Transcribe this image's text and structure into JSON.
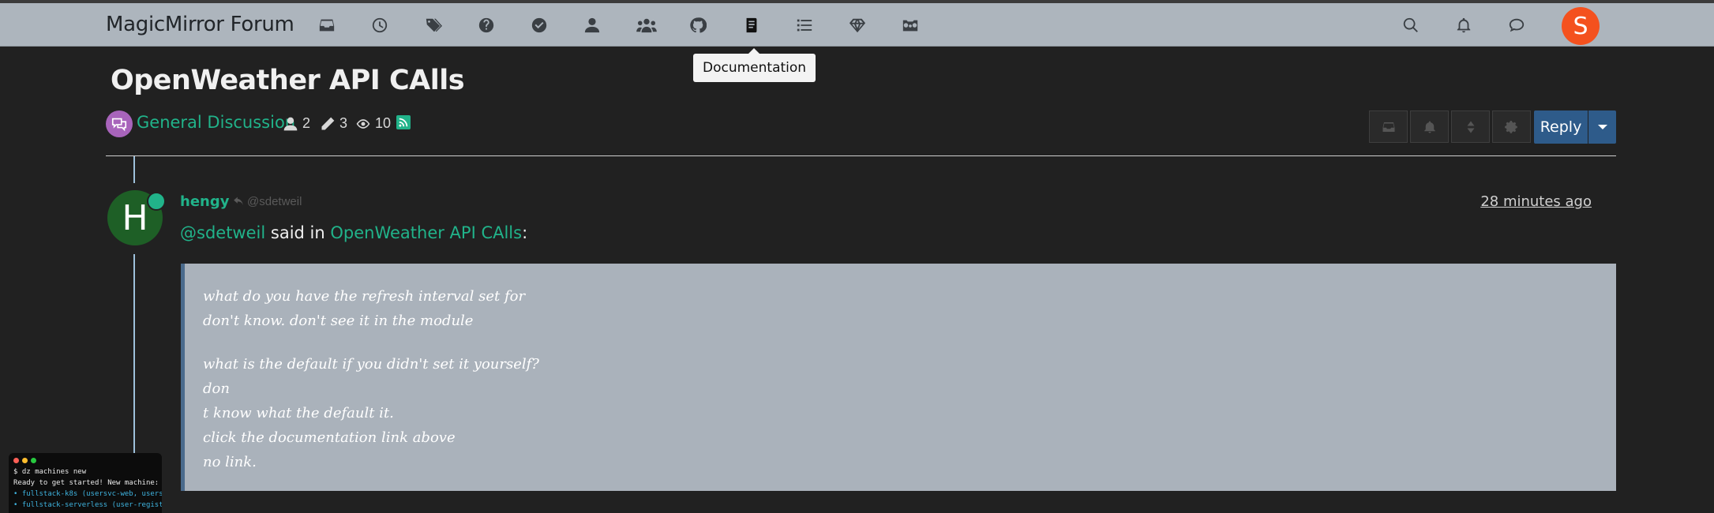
{
  "app": {
    "brand": "MagicMirror Forum"
  },
  "nav": {
    "items": [
      {
        "name": "unread-icon"
      },
      {
        "name": "recent-icon"
      },
      {
        "name": "tags-icon"
      },
      {
        "name": "help-icon"
      },
      {
        "name": "solved-icon"
      },
      {
        "name": "user-icon"
      },
      {
        "name": "groups-icon"
      },
      {
        "name": "github-icon"
      },
      {
        "name": "documentation-icon",
        "active": true
      },
      {
        "name": "list-icon"
      },
      {
        "name": "gem-icon"
      },
      {
        "name": "camera-icon"
      }
    ],
    "right": [
      "search-icon",
      "notifications-icon",
      "chat-icon"
    ],
    "user_avatar_letter": "S",
    "tooltip": "Documentation"
  },
  "topic": {
    "title": "OpenWeather API CAlls",
    "category": "General Discussion",
    "posters": "2",
    "posts": "3",
    "views": "10",
    "reply_label": "Reply"
  },
  "post": {
    "avatar_letter": "H",
    "author": "hengy",
    "reply_to": "@sdetweil",
    "time": "28 minutes ago",
    "mention": "@sdetweil",
    "said_in": " said in ",
    "topic_link": "OpenWeather API CAlls",
    "colon": ":",
    "quote": [
      "what do you have the refresh interval set for",
      "don't know. don't see it in the module",
      "",
      "what is the default if you didn't set it yourself?",
      "don",
      "t know what the default it.",
      "click the documentation link above",
      "no link."
    ]
  },
  "terminal": {
    "lines": [
      "$ dz machines new",
      "Ready to get started! New machine:",
      "• fullstack-k8s (usersvc-web, users",
      "• fullstack-serverless (user-regist"
    ]
  },
  "colors": {
    "accent": "#21b38a",
    "navbar": "#adb5bd",
    "reply": "#2e5b8a",
    "avatar_user": "#f4511e",
    "avatar_post": "#1e5f26"
  }
}
